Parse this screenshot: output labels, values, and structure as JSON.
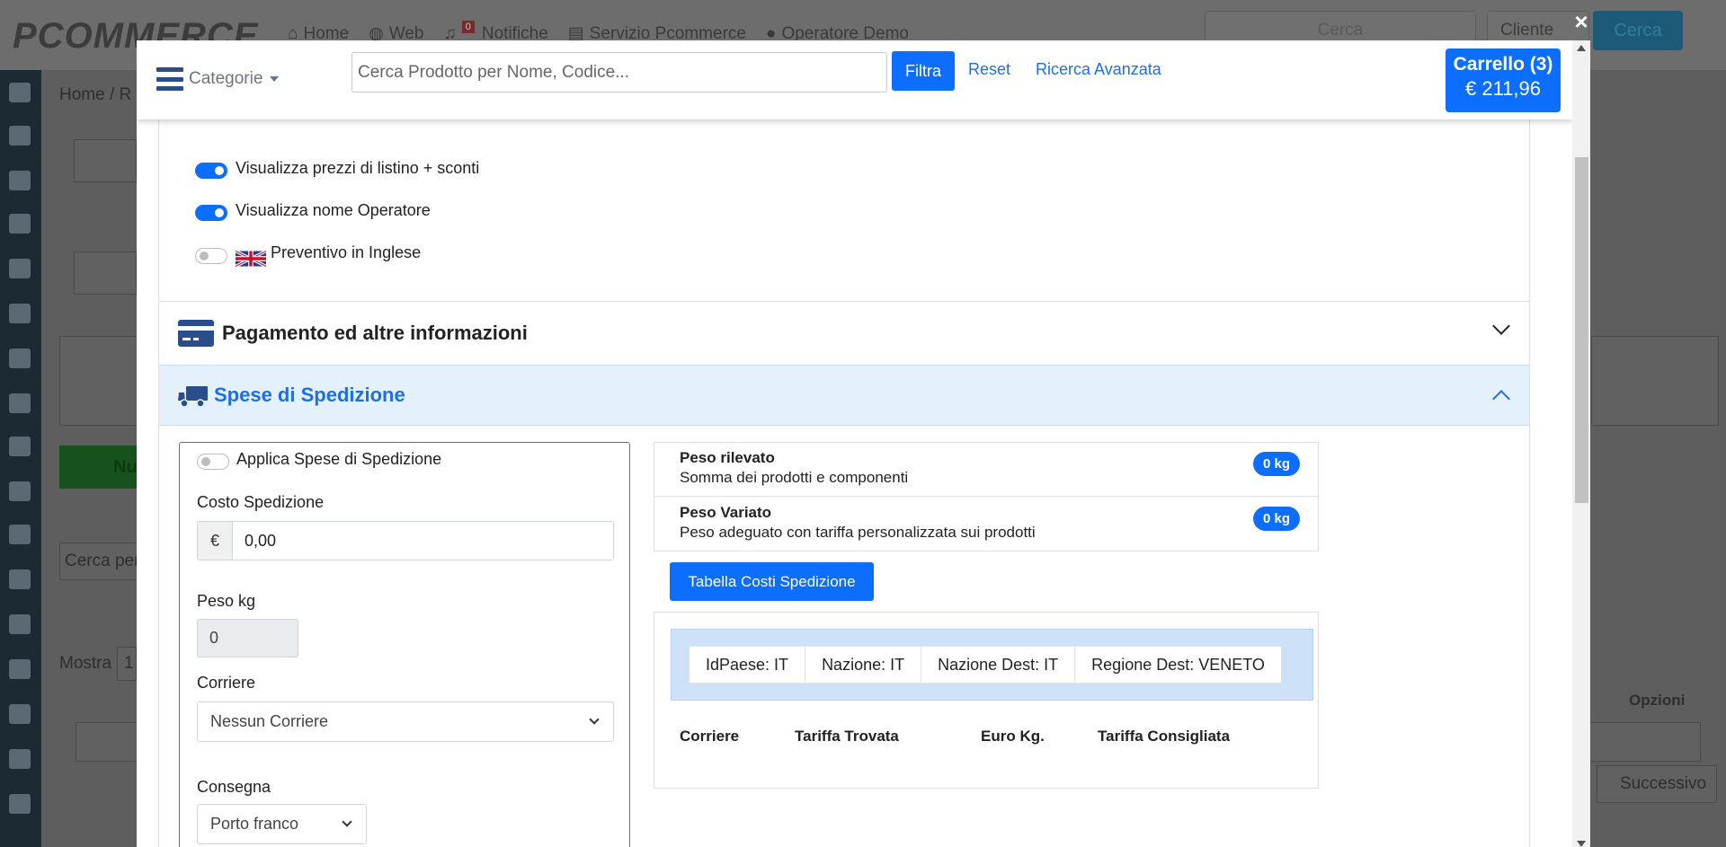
{
  "background": {
    "logo": "PCOMMERCE",
    "nav": [
      "Home",
      "Web",
      "Notifiche",
      "Servizio Pcommerce",
      "Operatore Demo"
    ],
    "notification_count": "0",
    "search_placeholder": "Cerca",
    "client_select": "Cliente",
    "search_button": "Cerca",
    "breadcrumb": "Home / R",
    "new_button": "Nu",
    "search_partial": "Cerca per",
    "show_label": "Mostra",
    "show_value": "1",
    "options_header": "Opzioni",
    "next_button": "Successivo"
  },
  "header": {
    "categories_label": "Categorie",
    "search_placeholder": "Cerca Prodotto per Nome, Codice...",
    "filter_button": "Filtra",
    "reset_link": "Reset",
    "advanced_link": "Ricerca Avanzata",
    "cart_title": "Carrello (3)",
    "cart_total": "€ 211,96",
    "close_symbol": "×"
  },
  "options": [
    {
      "label": "Visualizza prezzi di listino + sconti",
      "checked": true
    },
    {
      "label": "Visualizza nome Operatore",
      "checked": true
    },
    {
      "label": "Preventivo in Inglese",
      "checked": false,
      "icon": "uk-flag-icon"
    }
  ],
  "sections": {
    "payment": {
      "title": "Pagamento ed altre informazioni",
      "icon": "credit-card-icon",
      "expanded": false
    },
    "shipping": {
      "title": "Spese di Spedizione",
      "icon": "truck-icon",
      "expanded": true,
      "accent": "#1e6fe3"
    }
  },
  "shipping_form": {
    "apply_label": "Applica Spese di Spedizione",
    "apply_checked": false,
    "cost_label": "Costo Spedizione",
    "currency_symbol": "€",
    "cost_value": "0,00",
    "weight_label": "Peso kg",
    "weight_value": "0",
    "carrier_label": "Corriere",
    "carrier_value": "Nessun Corriere",
    "delivery_label": "Consegna",
    "delivery_value": "Porto franco"
  },
  "weights": [
    {
      "title": "Peso rilevato",
      "subtitle": "Somma dei prodotti e componenti",
      "badge": "0 kg"
    },
    {
      "title": "Peso Variato",
      "subtitle": "Peso adeguato con tariffa personalizzata sui prodotti",
      "badge": "0 kg"
    }
  ],
  "cost_table": {
    "button_label": "Tabella Costi Spedizione",
    "info": [
      "IdPaese: IT",
      "Nazione: IT",
      "Nazione Dest: IT",
      "Regione Dest: VENETO"
    ],
    "columns": [
      "Corriere",
      "Tariffa Trovata",
      "Euro Kg.",
      "Tariffa Consigliata"
    ]
  },
  "colors": {
    "primary": "#0d6efd",
    "accent_blue": "#1e6fe3",
    "section_bg": "#e5f0fd",
    "info_bg": "#cde1f9",
    "category_icon": "#2a4e8c"
  }
}
